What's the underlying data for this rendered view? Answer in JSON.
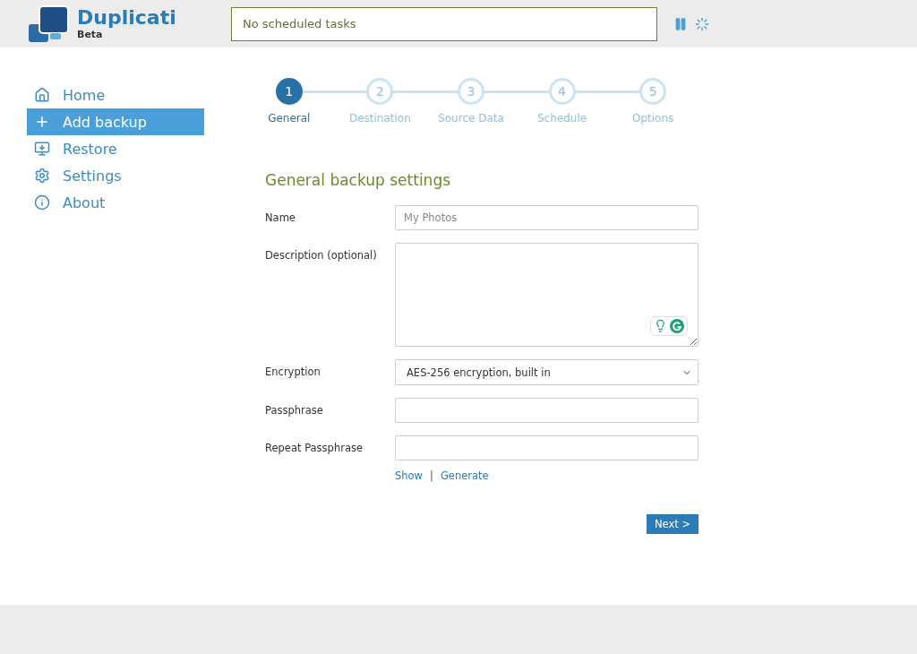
{
  "header": {
    "logo_title": "Duplicati",
    "logo_subtitle": "Beta",
    "status": "No scheduled tasks"
  },
  "sidebar": {
    "items": [
      {
        "label": "Home",
        "selected": false
      },
      {
        "label": "Add backup",
        "selected": true
      },
      {
        "label": "Restore",
        "selected": false
      },
      {
        "label": "Settings",
        "selected": false
      },
      {
        "label": "About",
        "selected": false
      }
    ]
  },
  "steps": [
    {
      "number": "1",
      "label": "General",
      "selected": true
    },
    {
      "number": "2",
      "label": "Destination",
      "selected": false
    },
    {
      "number": "3",
      "label": "Source Data",
      "selected": false
    },
    {
      "number": "4",
      "label": "Schedule",
      "selected": false
    },
    {
      "number": "5",
      "label": "Options",
      "selected": false
    }
  ],
  "form": {
    "title": "General backup settings",
    "fields": [
      {
        "kind": "text",
        "label": "Name",
        "placeholder": "My Photos"
      },
      {
        "kind": "textarea",
        "label": "Description (optional)"
      },
      {
        "kind": "select",
        "label": "Encryption",
        "value": "AES-256 encryption, built in"
      },
      {
        "kind": "password",
        "label": "Passphrase"
      },
      {
        "kind": "password",
        "label": "Repeat Passphrase"
      }
    ],
    "links": [
      "Show",
      "Generate"
    ],
    "separator": "|",
    "next_button": "Next >"
  }
}
